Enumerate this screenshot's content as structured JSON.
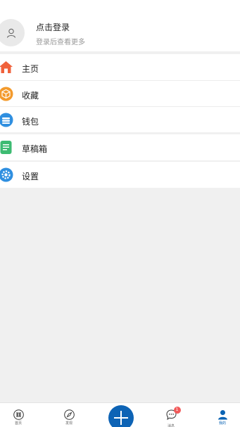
{
  "profile": {
    "title": "点击登录",
    "subtitle": "登录后查看更多"
  },
  "menu": [
    {
      "label": "主页",
      "icon": "home-icon",
      "color": "#f0623c"
    },
    {
      "label": "收藏",
      "icon": "box-icon",
      "color": "#f39a2c"
    },
    {
      "label": "钱包",
      "icon": "wallet-icon",
      "color": "#2f8fe0"
    },
    {
      "label": "草稿箱",
      "icon": "draft-icon",
      "color": "#3dbb72"
    },
    {
      "label": "设置",
      "icon": "gear-icon",
      "color": "#2f8fe0"
    }
  ],
  "tabbar": {
    "tabs": [
      {
        "label": "首页",
        "icon": "home-tab-icon"
      },
      {
        "label": "发现",
        "icon": "compass-icon"
      },
      {
        "label": "消息",
        "icon": "message-icon",
        "badge": "1"
      },
      {
        "label": "我的",
        "icon": "user-icon",
        "active": true
      }
    ],
    "accent": "#0d63b5"
  }
}
